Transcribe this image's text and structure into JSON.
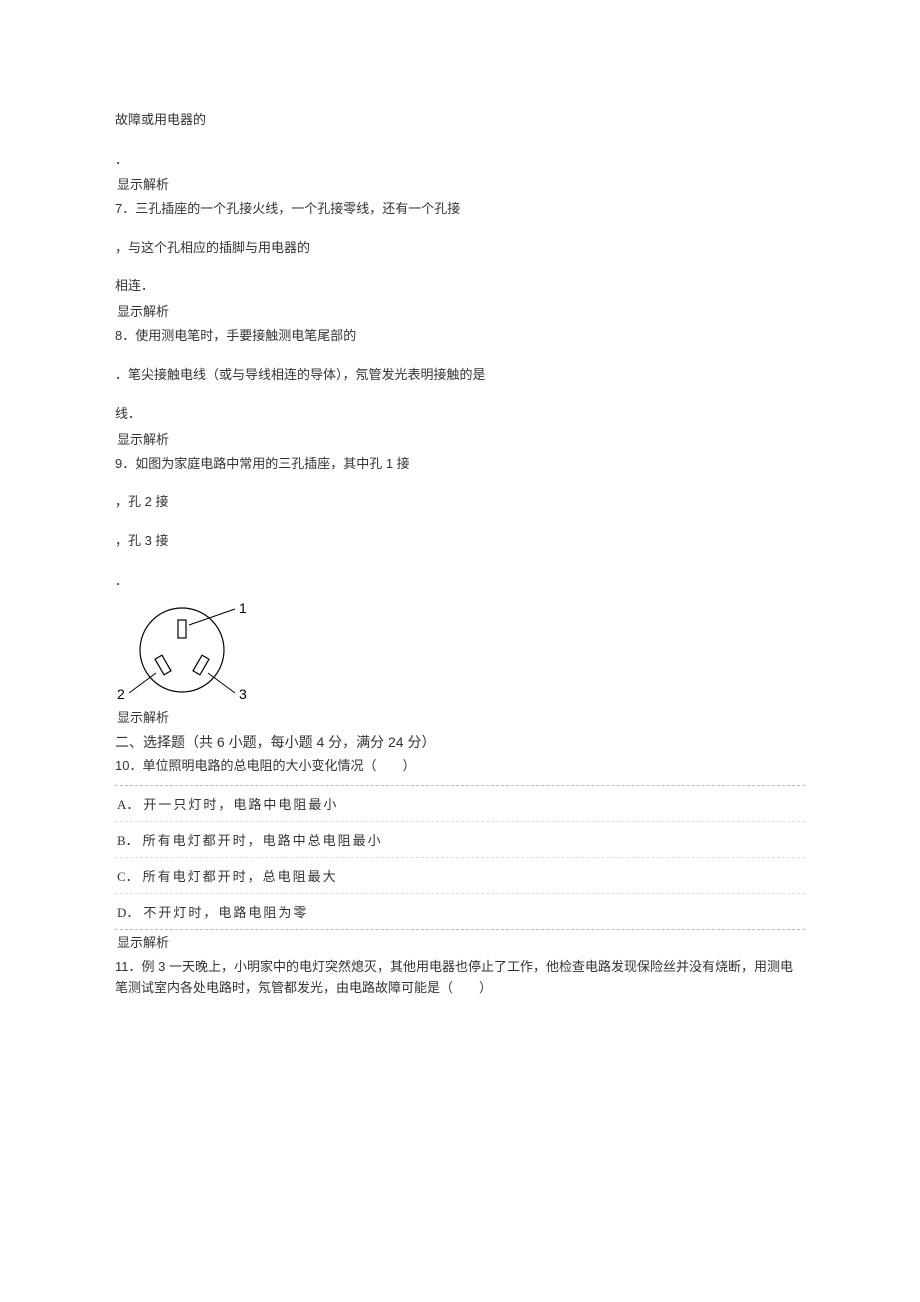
{
  "intro_fragment": "故障或用电器的",
  "show_explain": "显示解析",
  "q7": {
    "line1": "7．三孔插座的一个孔接火线，一个孔接零线，还有一个孔接",
    "line2": "，与这个孔相应的插脚与用电器的",
    "line3": "相连．"
  },
  "q8": {
    "line1": "8．使用测电笔时，手要接触测电笔尾部的",
    "line2": "．笔尖接触电线（或与导线相连的导体），氖管发光表明接触的是",
    "line3": "线．"
  },
  "q9": {
    "line1": "9．如图为家庭电路中常用的三孔插座，其中孔 1 接",
    "line2": "，孔 2 接",
    "line3": "，孔 3 接"
  },
  "section2_title": "二、选择题（共 6 小题，每小题 4 分，满分 24 分）",
  "q10": {
    "text": "10．单位照明电路的总电阻的大小变化情况（　　）",
    "options": {
      "A": "开一只灯时，电路中电阻最小",
      "B": "所有电灯都开时，电路中总电阻最小",
      "C": "所有电灯都开时，总电阻最大",
      "D": "不开灯时，电路电阻为零"
    }
  },
  "q11": {
    "text": "11．例 3 一天晚上，小明家中的电灯突然熄灭，其他用电器也停止了工作，他检查电路发现保险丝并没有烧断，用测电笔测试室内各处电路时，氖管都发光，由电路故障可能是（　　）"
  },
  "socket_labels": {
    "l1": "1",
    "l2": "2",
    "l3": "3"
  }
}
